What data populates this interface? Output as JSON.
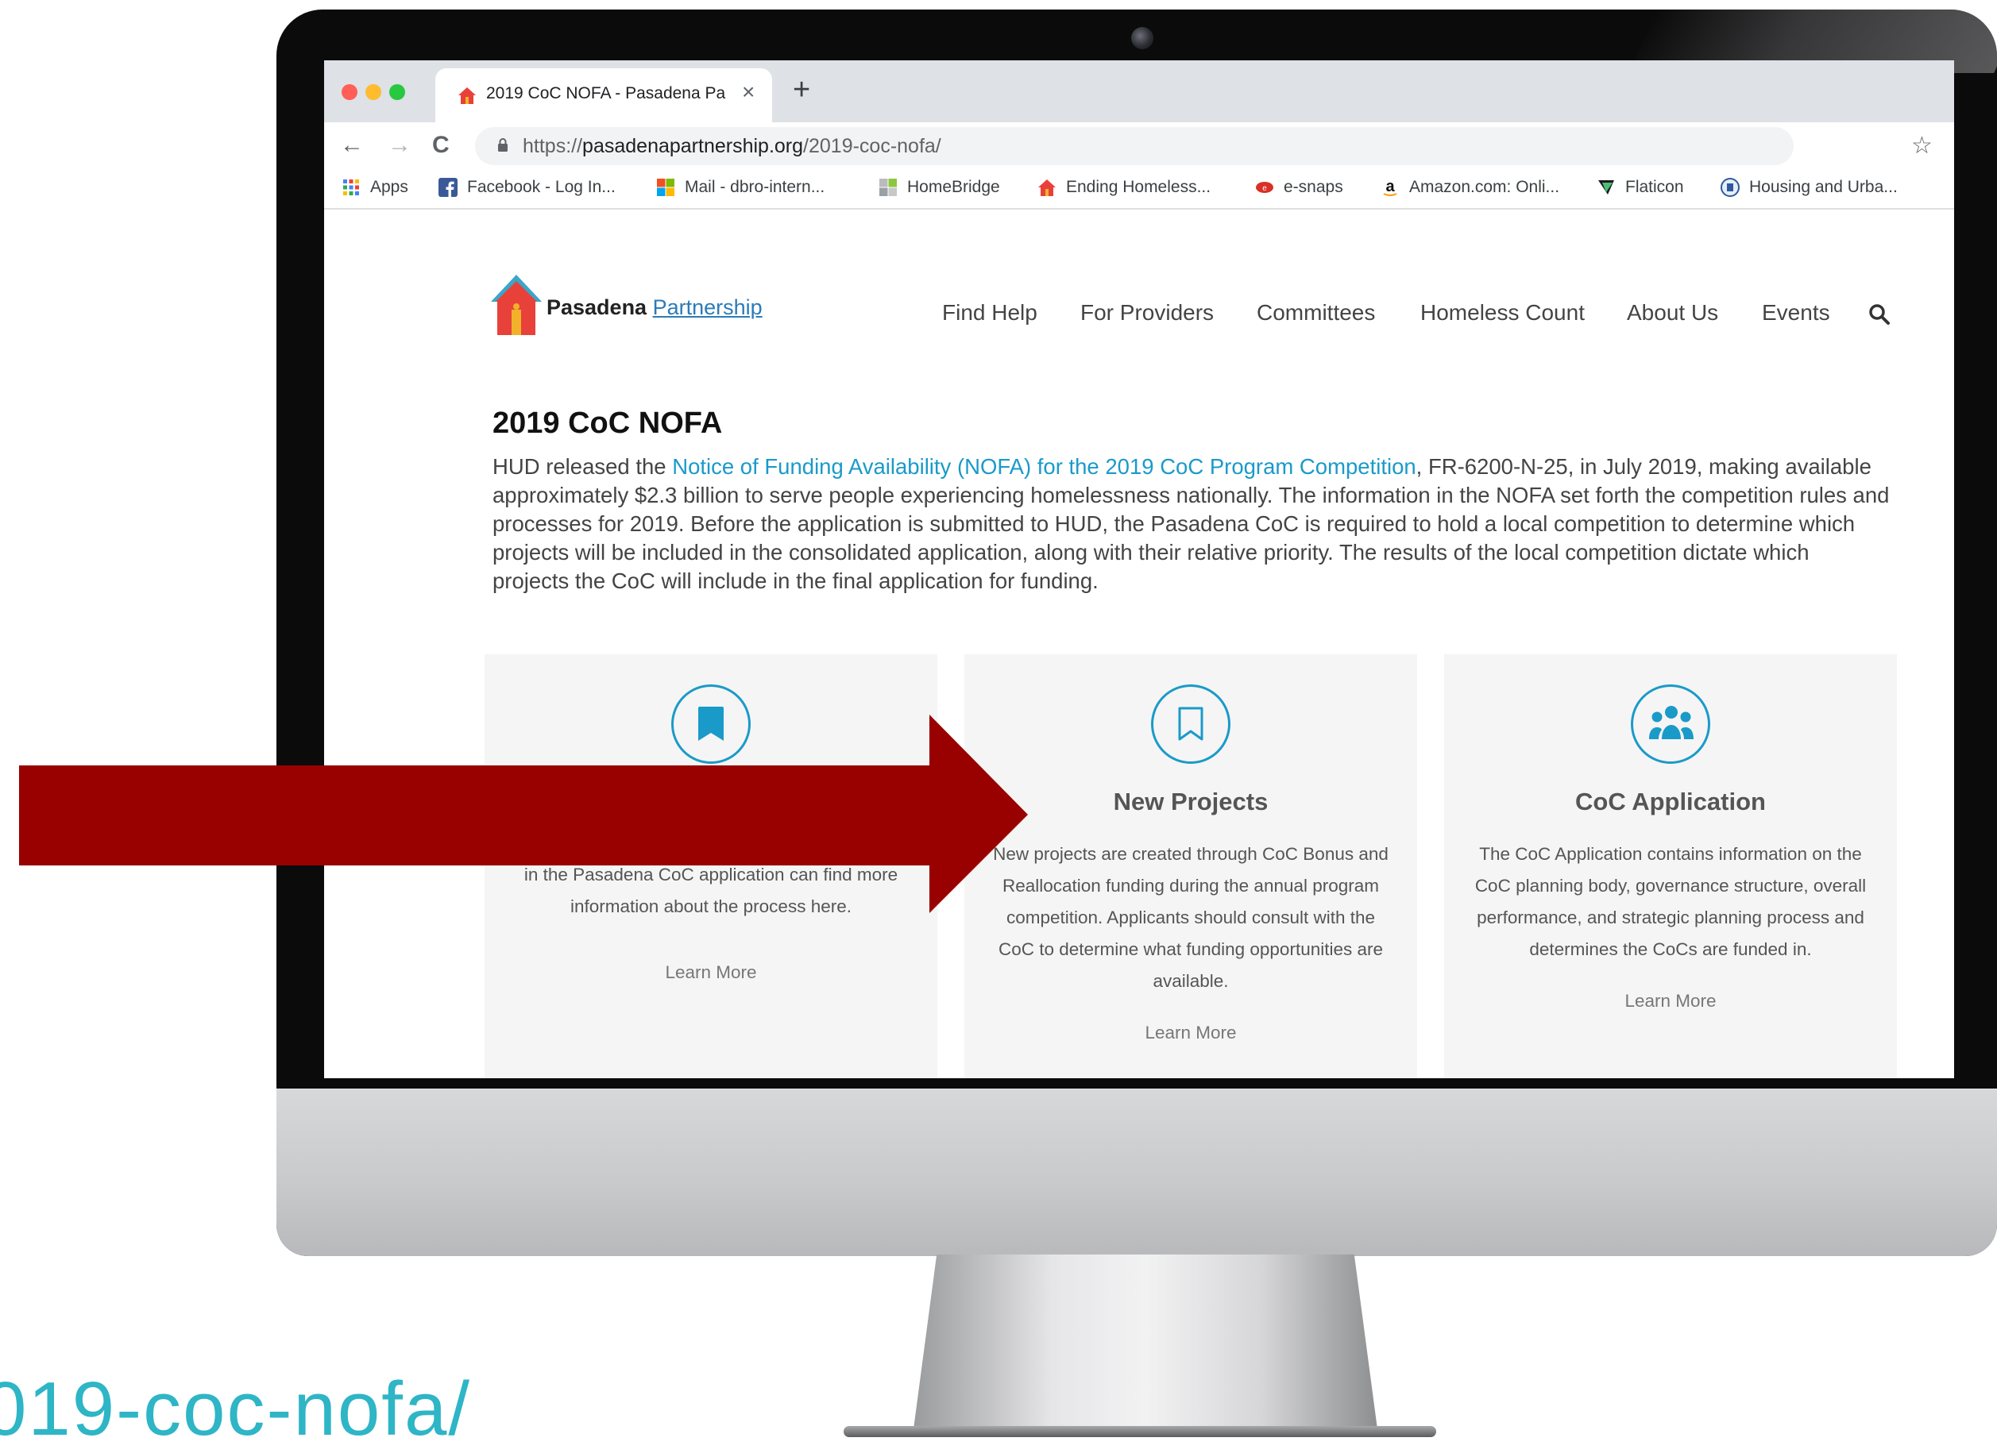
{
  "browser": {
    "tab_title": "2019 CoC NOFA - Pasadena Pa",
    "tab_close": "×",
    "new_tab": "+",
    "back": "←",
    "forward": "→",
    "reload": "C",
    "url_scheme": "https://",
    "url_host": "pasadenapartnership.org",
    "url_path": "/2019-coc-nofa/",
    "star": "☆",
    "bookmarks": [
      {
        "label": "Apps",
        "icon": "apps-grid-icon"
      },
      {
        "label": "Facebook - Log In...",
        "icon": "facebook-icon"
      },
      {
        "label": "Mail - dbro-intern...",
        "icon": "microsoft-icon"
      },
      {
        "label": "HomeBridge",
        "icon": "homebridge-icon"
      },
      {
        "label": "Ending Homeless...",
        "icon": "house-icon"
      },
      {
        "label": "e-snaps",
        "icon": "esnaps-icon"
      },
      {
        "label": "Amazon.com: Onli...",
        "icon": "amazon-icon"
      },
      {
        "label": "Flaticon",
        "icon": "flaticon-icon"
      },
      {
        "label": "Housing and Urba...",
        "icon": "hud-seal-icon"
      }
    ]
  },
  "site": {
    "logo_part1": "Pasadena",
    "logo_part2": "Partnership",
    "nav": [
      "Find Help",
      "For Providers",
      "Committees",
      "Homeless Count",
      "About Us",
      "Events"
    ],
    "page_title": "2019 CoC NOFA",
    "intro_before": "HUD released the ",
    "intro_link": "Notice of Funding Availability (NOFA) for the 2019 CoC Program Competition",
    "intro_after": ", FR-6200-N-25, in July 2019, making available approximately $2.3 billion to serve people experiencing homelessness nationally. The information in the NOFA set forth the competition rules and processes for 2019. Before the application is submitted to HUD, the Pasadena CoC is required to hold a local competition to determine which projects will be included in the consolidated application, along with their relative priority. The results of the local competition dictate which projects the CoC will include in the final application for funding.",
    "cards": [
      {
        "icon": "bookmark-filled-icon",
        "body_visible": "in the Pasadena CoC application can find more information about the process here.",
        "link": "Learn More"
      },
      {
        "icon": "bookmark-outline-icon",
        "title": "New Projects",
        "body": "New projects are created through CoC Bonus and Reallocation funding during the annual program competition. Applicants should consult with the CoC to determine what funding opportunities are available.",
        "link": "Learn More"
      },
      {
        "icon": "users-group-icon",
        "title": "CoC Application",
        "body": "The CoC Application contains information on the CoC planning body, governance structure, overall performance, and strategic planning process and determines the CoCs are funded in.",
        "link": "Learn More"
      }
    ]
  },
  "overlay": {
    "url_fragment": "019-coc-nofa/"
  },
  "colors": {
    "accent": "#1a9ac9",
    "arrow": "#990000",
    "overlay_text": "#2eb5c6"
  }
}
